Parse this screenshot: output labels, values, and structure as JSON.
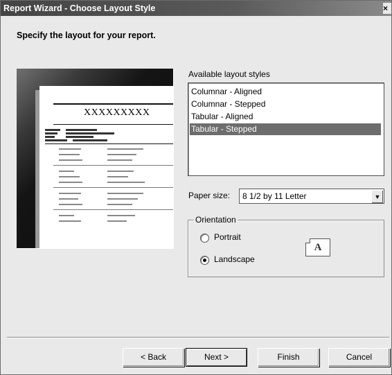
{
  "window": {
    "title": "Report Wizard - Choose Layout Style",
    "close_glyph": "×"
  },
  "heading": "Specify the layout for your report.",
  "preview": {
    "report_title": "XXXXXXXXX"
  },
  "layout_styles": {
    "label": "Available layout styles",
    "items": [
      {
        "label": "Columnar - Aligned",
        "selected": false
      },
      {
        "label": "Columnar - Stepped",
        "selected": false
      },
      {
        "label": "Tabular - Aligned",
        "selected": false
      },
      {
        "label": "Tabular - Stepped",
        "selected": true
      }
    ]
  },
  "paper_size": {
    "label": "Paper size:",
    "value": "8 1/2 by 11 Letter",
    "arrow_glyph": "▼"
  },
  "orientation": {
    "legend": "Orientation",
    "portrait_label": "Portrait",
    "landscape_label": "Landscape",
    "selected": "landscape",
    "icon_letter": "A"
  },
  "buttons": {
    "back": "< Back",
    "next": "Next >",
    "finish": "Finish",
    "cancel": "Cancel"
  },
  "colors": {
    "selection": "#6d6d6d",
    "titlebar": "#4a4a4a",
    "face": "#e9e9e9"
  }
}
